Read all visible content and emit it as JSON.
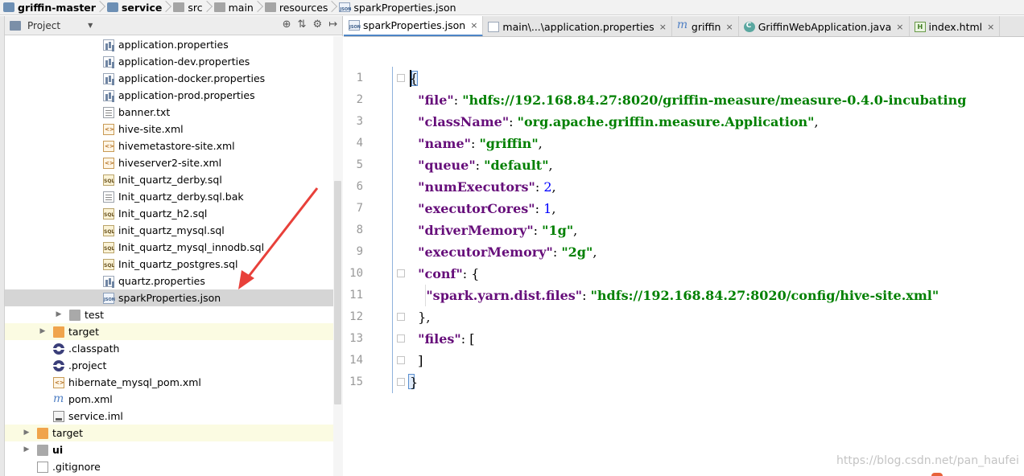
{
  "breadcrumb": [
    {
      "label": "griffin-master",
      "icon": "module-icon",
      "bold": true
    },
    {
      "label": "service",
      "icon": "module-icon",
      "bold": true
    },
    {
      "label": "src",
      "icon": "folder-icon",
      "bold": false
    },
    {
      "label": "main",
      "icon": "folder-icon",
      "bold": false
    },
    {
      "label": "resources",
      "icon": "folder-icon",
      "bold": false
    },
    {
      "label": "sparkProperties.json",
      "icon": "json-file-icon",
      "bold": false
    }
  ],
  "project_panel": {
    "title": "Project",
    "tools": [
      "⊕",
      "⇅",
      "⚙",
      "↦"
    ],
    "tree": [
      {
        "label": "application.properties",
        "icon": "props",
        "indent": 126,
        "arrow": ""
      },
      {
        "label": "application-dev.properties",
        "icon": "props",
        "indent": 126,
        "arrow": ""
      },
      {
        "label": "application-docker.properties",
        "icon": "props",
        "indent": 126,
        "arrow": ""
      },
      {
        "label": "application-prod.properties",
        "icon": "props",
        "indent": 126,
        "arrow": ""
      },
      {
        "label": "banner.txt",
        "icon": "txt",
        "indent": 126,
        "arrow": ""
      },
      {
        "label": "hive-site.xml",
        "icon": "xml",
        "indent": 126,
        "arrow": ""
      },
      {
        "label": "hivemetastore-site.xml",
        "icon": "xml",
        "indent": 126,
        "arrow": ""
      },
      {
        "label": "hiveserver2-site.xml",
        "icon": "xml",
        "indent": 126,
        "arrow": ""
      },
      {
        "label": "Init_quartz_derby.sql",
        "icon": "sql",
        "indent": 126,
        "arrow": ""
      },
      {
        "label": "Init_quartz_derby.sql.bak",
        "icon": "txt",
        "indent": 126,
        "arrow": ""
      },
      {
        "label": "Init_quartz_h2.sql",
        "icon": "sql",
        "indent": 126,
        "arrow": ""
      },
      {
        "label": "init_quartz_mysql.sql",
        "icon": "sql",
        "indent": 126,
        "arrow": ""
      },
      {
        "label": "Init_quartz_mysql_innodb.sql",
        "icon": "sql",
        "indent": 126,
        "arrow": ""
      },
      {
        "label": "Init_quartz_postgres.sql",
        "icon": "sql",
        "indent": 126,
        "arrow": ""
      },
      {
        "label": "quartz.properties",
        "icon": "props",
        "indent": 126,
        "arrow": ""
      },
      {
        "label": "sparkProperties.json",
        "icon": "json",
        "indent": 126,
        "arrow": "",
        "selected": true
      },
      {
        "label": "test",
        "icon": "folder",
        "indent": 84,
        "arrow": "▶"
      },
      {
        "label": "target",
        "icon": "folder-orange",
        "indent": 64,
        "arrow": "▶",
        "highlight": true
      },
      {
        "label": ".classpath",
        "icon": "eclipse",
        "indent": 64,
        "arrow": ""
      },
      {
        "label": ".project",
        "icon": "eclipse",
        "indent": 64,
        "arrow": ""
      },
      {
        "label": "hibernate_mysql_pom.xml",
        "icon": "xml",
        "indent": 64,
        "arrow": ""
      },
      {
        "label": "pom.xml",
        "icon": "maven",
        "indent": 64,
        "arrow": ""
      },
      {
        "label": "service.iml",
        "icon": "iml",
        "indent": 64,
        "arrow": ""
      },
      {
        "label": "target",
        "icon": "folder-orange",
        "indent": 44,
        "arrow": "▶",
        "highlight": true
      },
      {
        "label": "ui",
        "icon": "folder",
        "indent": 44,
        "arrow": "▶",
        "bold": true
      },
      {
        "label": ".gitignore",
        "icon": "gitignore",
        "indent": 44,
        "arrow": ""
      }
    ]
  },
  "tabs": [
    {
      "label": "sparkProperties.json",
      "icon": "json",
      "active": true
    },
    {
      "label": "main\\...\\application.properties",
      "icon": "props",
      "active": false
    },
    {
      "label": "griffin",
      "icon": "maven",
      "active": false
    },
    {
      "label": "GriffinWebApplication.java",
      "icon": "java",
      "active": false
    },
    {
      "label": "index.html",
      "icon": "html",
      "active": false
    }
  ],
  "tab_close_glyph": "×",
  "editor": {
    "lines": [
      {
        "n": "1",
        "tokens": [
          {
            "t": "p",
            "v": "{"
          }
        ]
      },
      {
        "n": "2",
        "tokens": [
          {
            "t": "p",
            "v": "  "
          },
          {
            "t": "k",
            "v": "\"file\""
          },
          {
            "t": "p",
            "v": ": "
          },
          {
            "t": "s",
            "v": "\"hdfs://192.168.84.27:8020/griffin-measure/measure-0.4.0-incubating"
          }
        ]
      },
      {
        "n": "3",
        "tokens": [
          {
            "t": "p",
            "v": "  "
          },
          {
            "t": "k",
            "v": "\"className\""
          },
          {
            "t": "p",
            "v": ": "
          },
          {
            "t": "s",
            "v": "\"org.apache.griffin.measure.Application\""
          },
          {
            "t": "p",
            "v": ","
          }
        ]
      },
      {
        "n": "4",
        "tokens": [
          {
            "t": "p",
            "v": "  "
          },
          {
            "t": "k",
            "v": "\"name\""
          },
          {
            "t": "p",
            "v": ": "
          },
          {
            "t": "s",
            "v": "\"griffin\""
          },
          {
            "t": "p",
            "v": ","
          }
        ]
      },
      {
        "n": "5",
        "tokens": [
          {
            "t": "p",
            "v": "  "
          },
          {
            "t": "k",
            "v": "\"queue\""
          },
          {
            "t": "p",
            "v": ": "
          },
          {
            "t": "s",
            "v": "\"default\""
          },
          {
            "t": "p",
            "v": ","
          }
        ]
      },
      {
        "n": "6",
        "tokens": [
          {
            "t": "p",
            "v": "  "
          },
          {
            "t": "k",
            "v": "\"numExecutors\""
          },
          {
            "t": "p",
            "v": ": "
          },
          {
            "t": "n",
            "v": "2"
          },
          {
            "t": "p",
            "v": ","
          }
        ]
      },
      {
        "n": "7",
        "tokens": [
          {
            "t": "p",
            "v": "  "
          },
          {
            "t": "k",
            "v": "\"executorCores\""
          },
          {
            "t": "p",
            "v": ": "
          },
          {
            "t": "n",
            "v": "1"
          },
          {
            "t": "p",
            "v": ","
          }
        ]
      },
      {
        "n": "8",
        "tokens": [
          {
            "t": "p",
            "v": "  "
          },
          {
            "t": "k",
            "v": "\"driverMemory\""
          },
          {
            "t": "p",
            "v": ": "
          },
          {
            "t": "s",
            "v": "\"1g\""
          },
          {
            "t": "p",
            "v": ","
          }
        ]
      },
      {
        "n": "9",
        "tokens": [
          {
            "t": "p",
            "v": "  "
          },
          {
            "t": "k",
            "v": "\"executorMemory\""
          },
          {
            "t": "p",
            "v": ": "
          },
          {
            "t": "s",
            "v": "\"2g\""
          },
          {
            "t": "p",
            "v": ","
          }
        ]
      },
      {
        "n": "10",
        "tokens": [
          {
            "t": "p",
            "v": "  "
          },
          {
            "t": "k",
            "v": "\"conf\""
          },
          {
            "t": "p",
            "v": ": {"
          }
        ]
      },
      {
        "n": "11",
        "tokens": [
          {
            "t": "p",
            "v": "    "
          },
          {
            "t": "k",
            "v": "\"spark.yarn.dist.files\""
          },
          {
            "t": "p",
            "v": ": "
          },
          {
            "t": "s",
            "v": "\"hdfs://192.168.84.27:8020/config/hive-site.xml\""
          }
        ]
      },
      {
        "n": "12",
        "tokens": [
          {
            "t": "p",
            "v": "  },"
          }
        ]
      },
      {
        "n": "13",
        "tokens": [
          {
            "t": "p",
            "v": "  "
          },
          {
            "t": "k",
            "v": "\"files\""
          },
          {
            "t": "p",
            "v": ": ["
          }
        ]
      },
      {
        "n": "14",
        "tokens": [
          {
            "t": "p",
            "v": "  ]"
          }
        ]
      },
      {
        "n": "15",
        "tokens": [
          {
            "t": "p",
            "v": "}"
          }
        ]
      }
    ],
    "fold_lines": [
      1,
      10,
      12,
      13,
      14,
      15
    ]
  },
  "watermark": "https://blog.csdn.net/pan_haufei",
  "colors": {
    "key": "#660e7a",
    "string": "#008000",
    "number": "#0000ff",
    "selection": "#d5d5d5",
    "arrow": "#e8403a"
  }
}
